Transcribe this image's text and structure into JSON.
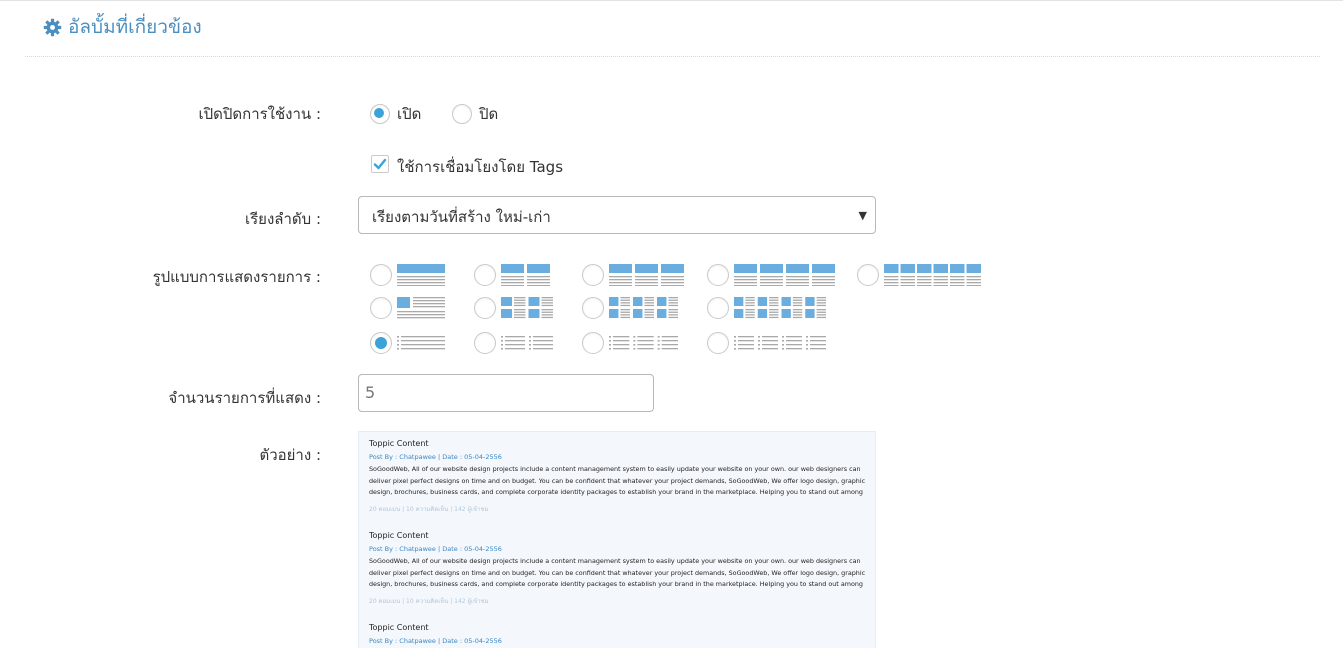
{
  "section": {
    "title": "อัลบั้มที่เกี่ยวข้อง",
    "icon": "gear-icon"
  },
  "status": {
    "label": "เปิดปิดการใช้งาน :",
    "on_label": "เปิด",
    "off_label": "ปิด",
    "selected": "on"
  },
  "tags_option": {
    "label": "ใช้การเชื่อมโยงโดย Tags",
    "checked": true
  },
  "sort": {
    "label": "เรียงลำดับ :",
    "value": "เรียงตามวันที่สร้าง ใหม่-เก่า"
  },
  "layout": {
    "label": "รูปแบบการแสดงรายการ :",
    "selected": "list-1col",
    "options": [
      "banner-1col",
      "banner-2col",
      "banner-3col",
      "banner-4col",
      "banner-6col",
      "thumb-1col",
      "thumb-2col",
      "thumb-3col",
      "thumb-4col",
      "list-1col",
      "list-2col",
      "list-3col",
      "list-4col"
    ]
  },
  "count": {
    "label": "จำนวนรายการที่แสดง :",
    "value": "5"
  },
  "preview": {
    "label": "ตัวอย่าง :",
    "items": [
      {
        "title": "Toppic Content",
        "meta": "Post By : Chatpawee  |  Date : 05-04-2556",
        "body": "SoGoodWeb, All of our website design projects include a content management system to easily update your website on your own. our web designers can deliver pixel perfect designs on time and on budget. You can be confident that whatever your project demands, SoGoodWeb, We offer logo design, graphic design, brochures, business cards, and complete corporate identity packages to establish your brand in the marketplace. Helping you to stand out among",
        "stats": "20 คอมเมน | 10 ความคิดเห็น | 142 ผู้เข้าชม"
      },
      {
        "title": "Toppic Content",
        "meta": "Post By : Chatpawee  |  Date : 05-04-2556",
        "body": "SoGoodWeb, All of our website design projects include a content management system to easily update your website on your own. our web designers can deliver pixel perfect designs on time and on budget. You can be confident that whatever your project demands, SoGoodWeb, We offer logo design, graphic design, brochures, business cards, and complete corporate identity packages to establish your brand in the marketplace. Helping you to stand out among",
        "stats": "20 คอมเมน | 10 ความคิดเห็น | 142 ผู้เข้าชม"
      },
      {
        "title": "Toppic Content",
        "meta": "Post By : Chatpawee  |  Date : 05-04-2556",
        "body": "",
        "stats": ""
      }
    ]
  },
  "colors": {
    "accent": "#3ca3d9",
    "title": "#4a8fc0",
    "icon_blue": "#6aaee0",
    "icon_gray": "#a9a9a9"
  }
}
